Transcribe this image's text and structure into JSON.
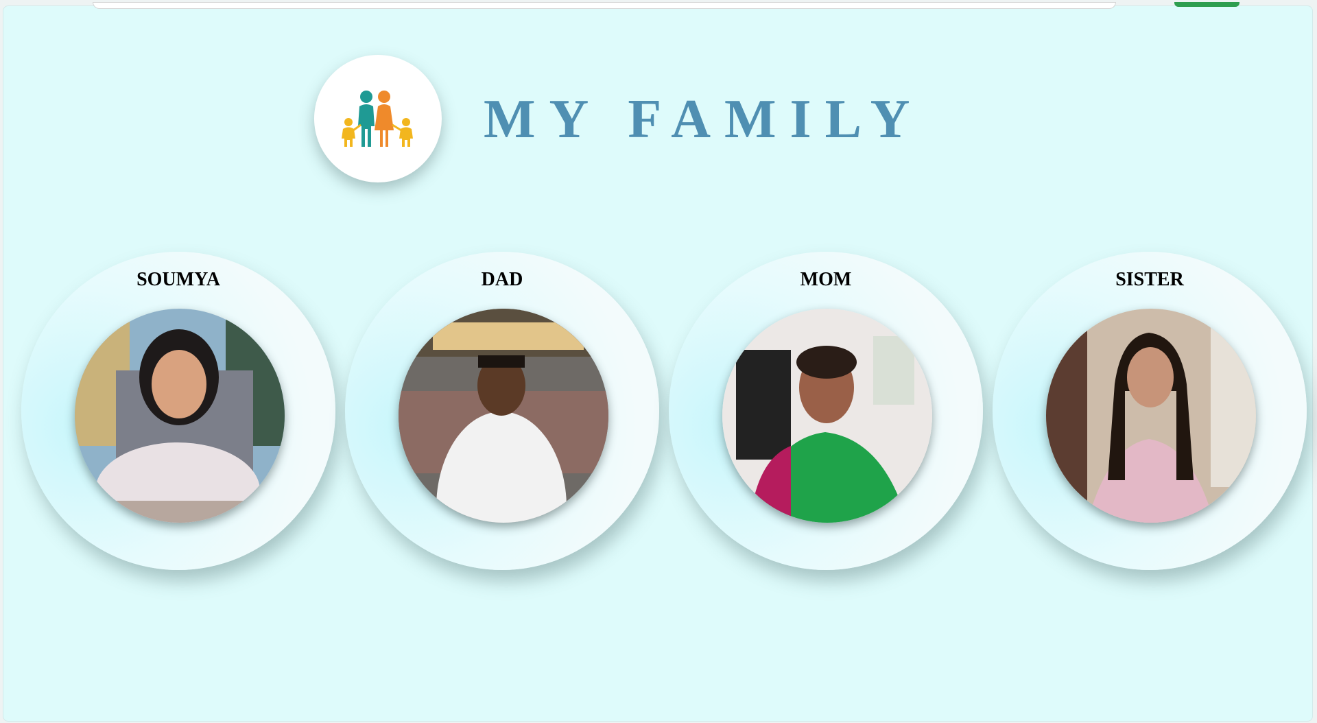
{
  "header": {
    "title": "MY FAMILY",
    "logo_icon": "family-icon"
  },
  "members": [
    {
      "name": "SOUMYA",
      "photo_icon": "portrait-photo"
    },
    {
      "name": "DAD",
      "photo_icon": "portrait-photo"
    },
    {
      "name": "MOM",
      "photo_icon": "portrait-photo"
    },
    {
      "name": "SISTER",
      "photo_icon": "portrait-photo"
    }
  ],
  "colors": {
    "page_background": "#defbfb",
    "title": "#4f8fb2",
    "logo_teal": "#1f9a94",
    "logo_orange": "#ef8a2b",
    "logo_yellow": "#f2b61e"
  }
}
